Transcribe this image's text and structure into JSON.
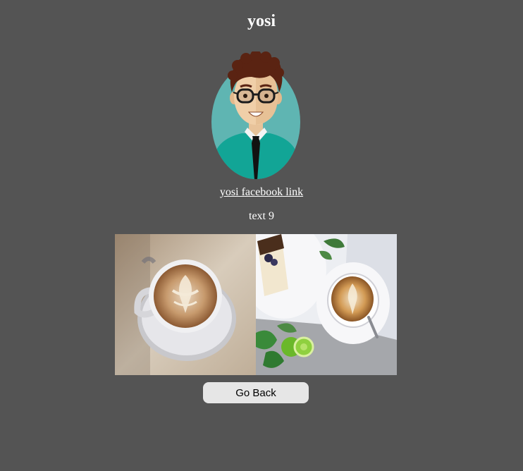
{
  "header": {
    "title": "yosi"
  },
  "profile": {
    "avatar_icon": "man-avatar-with-glasses",
    "facebook_link_label": "yosi facebook link",
    "text": "text 9"
  },
  "gallery": {
    "images": [
      {
        "name": "latte-art-cup-photo"
      },
      {
        "name": "coffee-and-cake-photo"
      }
    ]
  },
  "actions": {
    "go_back_label": "Go Back"
  },
  "colors": {
    "background": "#545454",
    "button_bg": "#e6e6e6",
    "text": "#ffffff"
  }
}
